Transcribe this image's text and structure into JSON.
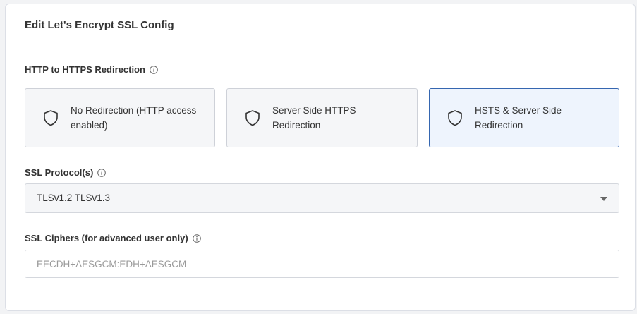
{
  "card": {
    "title": "Edit Let's Encrypt SSL Config"
  },
  "redirection": {
    "label": "HTTP to HTTPS Redirection",
    "options": [
      {
        "line1": "No Redirection (HTTP access",
        "line2": "enabled)",
        "selected": false
      },
      {
        "line1": "Server Side HTTPS",
        "line2": "Redirection",
        "selected": false
      },
      {
        "line1": "HSTS & Server Side",
        "line2": "Redirection",
        "selected": true
      }
    ]
  },
  "protocols": {
    "label": "SSL Protocol(s)",
    "value": "TLSv1.2 TLSv1.3"
  },
  "ciphers": {
    "label": "SSL Ciphers (for advanced user only)",
    "placeholder": "EECDH+AESGCM:EDH+AESGCM",
    "value": ""
  },
  "icons": {
    "info": "info-circle-icon",
    "option": "shield-icon",
    "dropdown": "caret-down-icon"
  },
  "colors": {
    "selected_border": "#3566b0",
    "selected_background": "#eef4fd"
  }
}
